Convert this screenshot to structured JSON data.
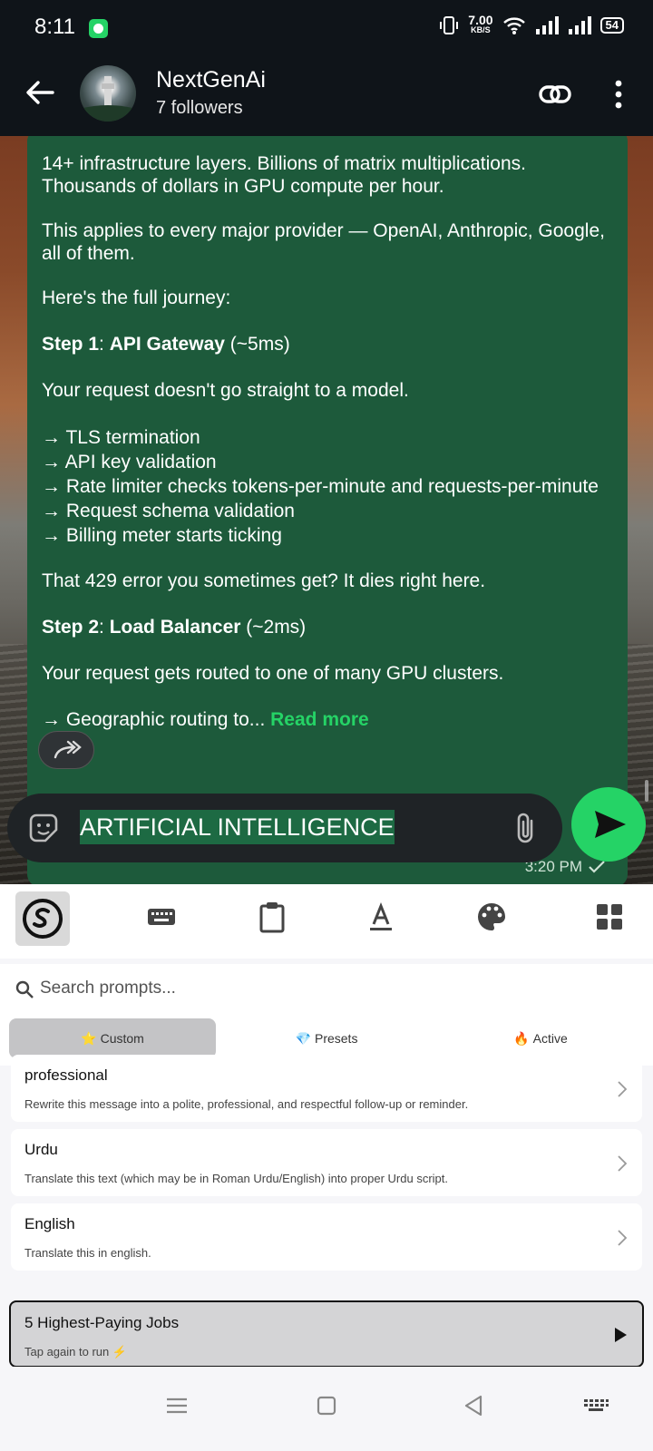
{
  "status_bar": {
    "time": "8:11",
    "net_speed_value": "7.00",
    "net_speed_unit": "KB/S",
    "battery": "54"
  },
  "chat_header": {
    "channel_name": "NextGenAi",
    "followers": "7 followers"
  },
  "message": {
    "p1": "14+ infrastructure layers. Billions of matrix multiplications. Thousands of dollars in GPU compute per hour.",
    "p2": "This applies to every major provider — OpenAI, Anthropic, Google, all of them.",
    "p3": "Here's the full journey:",
    "step1_label": "Step 1",
    "step1_sep": ": ",
    "step1_title": "API Gateway",
    "step1_time": " (~5ms)",
    "p4": "Your request doesn't go straight to a model.",
    "list1": [
      "→ TLS termination",
      "→ API key validation",
      "→ Rate limiter checks tokens-per-minute and requests-per-minute",
      "→ Request schema validation",
      "→ Billing meter starts ticking"
    ],
    "p5": "That 429 error you sometimes get? It dies right here.",
    "step2_label": "Step 2",
    "step2_sep": ": ",
    "step2_title": "Load Balancer",
    "step2_time": " (~2ms)",
    "p6": "Your request gets routed to one of many GPU clusters.",
    "p7": "→ Geographic routing to... ",
    "read_more": "Read more",
    "timestamp": "3:20 PM"
  },
  "composer": {
    "text": "ARTIFICIAL INTELLIGENCE"
  },
  "keyboard_panel": {
    "search_placeholder": "Search prompts...",
    "tabs": [
      {
        "emoji": "⭐",
        "label": "Custom"
      },
      {
        "emoji": "💎",
        "label": "Presets"
      },
      {
        "emoji": "🔥",
        "label": "Active"
      }
    ],
    "items": [
      {
        "title": "professional",
        "desc": "Rewrite this message into a polite, professional, and respectful follow-up or reminder."
      },
      {
        "title": "Urdu",
        "desc": "Translate this text (which may be in Roman Urdu/English) into proper Urdu script."
      },
      {
        "title": "English",
        "desc": "Translate this in english."
      }
    ],
    "run_item": {
      "title": "5 Highest-Paying Jobs",
      "desc": "Tap again to run ⚡"
    }
  },
  "colors": {
    "bubble": "#1d5a3b",
    "accent_green": "#25d366",
    "header_bg": "#0f1419"
  }
}
